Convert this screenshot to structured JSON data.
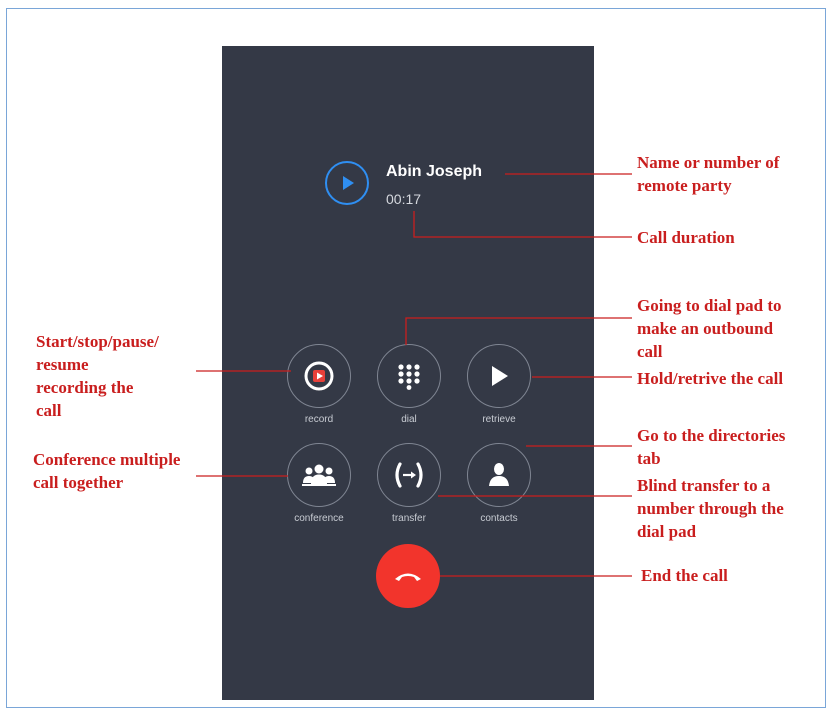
{
  "call": {
    "caller_name": "Abin Joseph",
    "duration": "00:17"
  },
  "controls": {
    "record": "record",
    "dial": "dial",
    "retrieve": "retrieve",
    "conference": "conference",
    "transfer": "transfer",
    "contacts": "contacts"
  },
  "annotations": {
    "remote_party": "Name or number of\nremote party",
    "call_duration": "Call duration",
    "dial_pad": "Going to dial pad to\nmake an outbound\ncall",
    "hold": "Hold/retrive the call",
    "directories": "Go to the directories\ntab",
    "blind_transfer": "Blind transfer to a\nnumber through the\ndial pad",
    "end_call": "End the call",
    "record": "Start/stop/pause/\nresume\nrecording the\ncall",
    "conference": "Conference multiple\ncall together"
  },
  "colors": {
    "phone_bg": "#343946",
    "accent_blue": "#2f8ff2",
    "end_call_red": "#f2342c",
    "annotation_red": "#c91e1e"
  },
  "icons": {
    "avatar": "play-circle-icon",
    "record": "record-icon",
    "dial": "keypad-icon",
    "retrieve": "play-icon",
    "conference": "group-icon",
    "transfer": "transfer-icon",
    "contacts": "person-icon",
    "end_call": "hangup-icon"
  }
}
